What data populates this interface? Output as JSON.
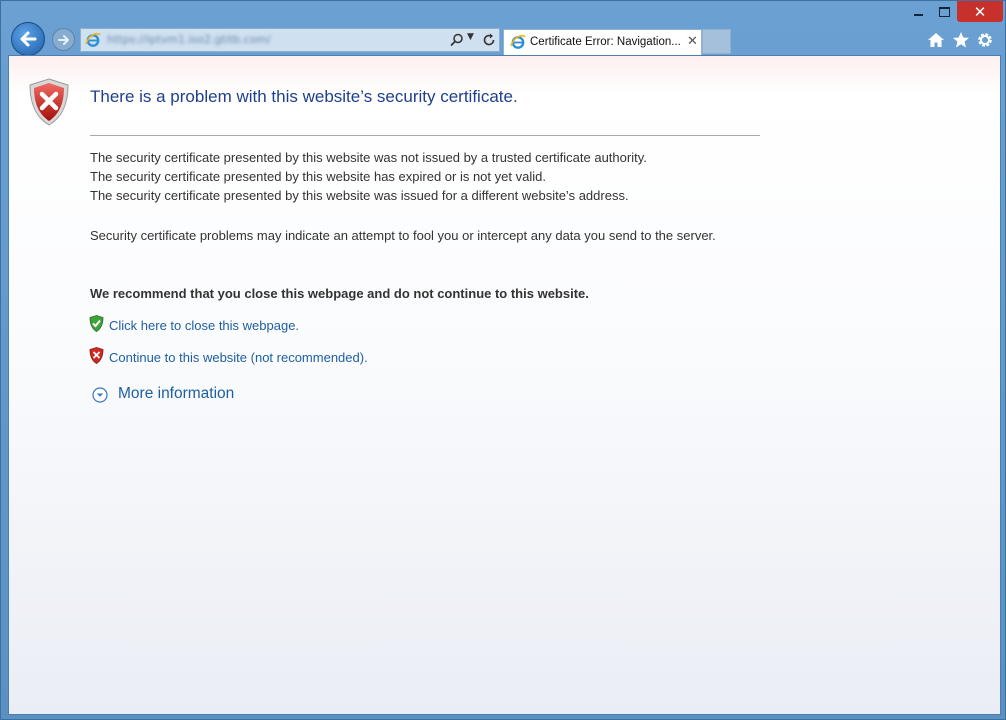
{
  "browser": {
    "address_url": "https://iptvm1.iso2.gtitb.com/",
    "tab_title": "Certificate Error: Navigation...",
    "tab_close": "✕",
    "window_close": "✕"
  },
  "page": {
    "title": "There is a problem with this website’s security certificate.",
    "lines": [
      "The security certificate presented by this website was not issued by a trusted certificate authority.",
      "The security certificate presented by this website has expired or is not yet valid.",
      "The security certificate presented by this website was issued for a different website’s address."
    ],
    "warning": "Security certificate problems may indicate an attempt to fool you or intercept any data you send to the server.",
    "recommendation": "We recommend that you close this webpage and do not continue to this website.",
    "close_link": "Click here to close this webpage.",
    "continue_link": "Continue to this website (not recommended).",
    "more_info": "More information"
  },
  "icons": [
    "back-arrow-icon",
    "forward-arrow-icon",
    "ie-logo-icon",
    "search-icon",
    "refresh-icon",
    "home-icon",
    "favorites-star-icon",
    "gear-icon",
    "error-shield-icon",
    "green-shield-icon",
    "red-shield-icon",
    "expand-chevron-icon"
  ],
  "colors": {
    "title": "#1f3f8e",
    "link": "#1e5fa3",
    "window_frame": "#5b90c3",
    "close_button": "#c7302b"
  }
}
